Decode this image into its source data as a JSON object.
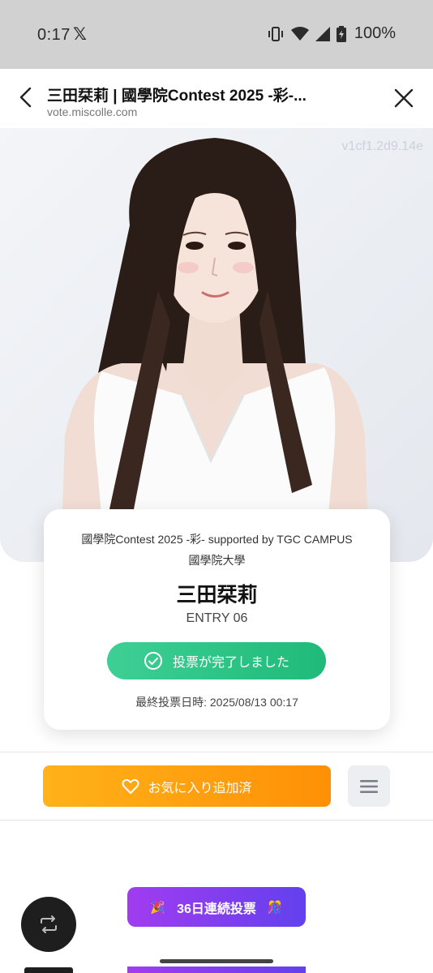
{
  "status_bar": {
    "time": "0:17",
    "x_logo": "𝕏",
    "battery_text": "100%"
  },
  "browser": {
    "title": "三田栞莉 | 國學院Contest 2025 -彩-...",
    "url": "vote.miscolle.com"
  },
  "hero": {
    "watermark": "v1cf1.2d9.14e"
  },
  "profile": {
    "contest": "國學院Contest 2025 -彩- supported by TGC CAMPUS",
    "university": "國學院大學",
    "name": "三田栞莉",
    "entry": "ENTRY 06",
    "vote_button": "投票が完了しました",
    "last_vote": "最終投票日時: 2025/08/13 00:17"
  },
  "actions": {
    "favorite_label": "お気に入り追加済"
  },
  "bottom": {
    "streak_label": "36日連続投票",
    "party_left": "🎉",
    "party_right": "🎊"
  },
  "colors": {
    "vote_green": "#1fba7a",
    "favorite_orange": "#ff9b0d",
    "streak_purple": "#8a3df0"
  }
}
